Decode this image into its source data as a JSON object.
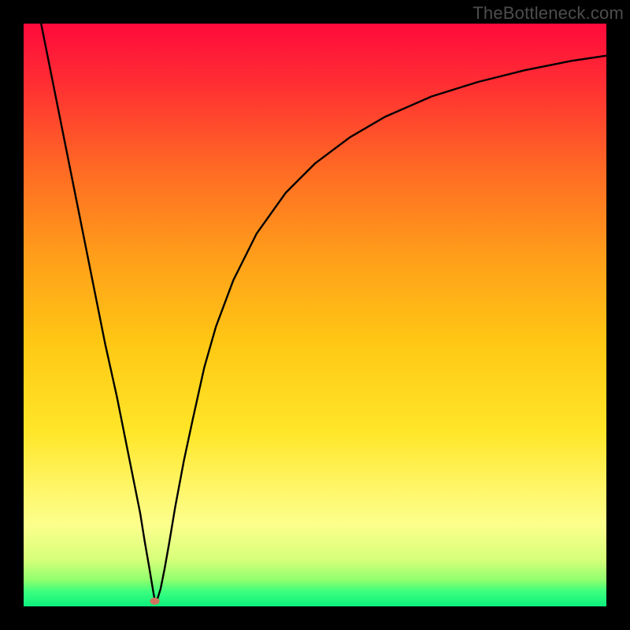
{
  "watermark": "TheBottleneck.com",
  "chart_data": {
    "type": "line",
    "title": "",
    "xlabel": "",
    "ylabel": "",
    "xlim": [
      0,
      100
    ],
    "ylim": [
      0,
      100
    ],
    "grid": false,
    "background_gradient": {
      "stops": [
        {
          "offset": 0.0,
          "color": "#ff0a3c"
        },
        {
          "offset": 0.1,
          "color": "#ff2d33"
        },
        {
          "offset": 0.25,
          "color": "#ff6a24"
        },
        {
          "offset": 0.4,
          "color": "#ff9e1a"
        },
        {
          "offset": 0.55,
          "color": "#ffc814"
        },
        {
          "offset": 0.7,
          "color": "#ffe628"
        },
        {
          "offset": 0.8,
          "color": "#fff66a"
        },
        {
          "offset": 0.86,
          "color": "#fcff8c"
        },
        {
          "offset": 0.92,
          "color": "#d6ff7a"
        },
        {
          "offset": 0.955,
          "color": "#8fff6e"
        },
        {
          "offset": 0.975,
          "color": "#3bff7e"
        },
        {
          "offset": 1.0,
          "color": "#0cf07e"
        }
      ]
    },
    "series": [
      {
        "name": "bottleneck-curve",
        "color": "#000000",
        "width": 2.4,
        "x": [
          3,
          4,
          6,
          8,
          10,
          12,
          14,
          16,
          18,
          19,
          20,
          20.8,
          21.5,
          22,
          22.3,
          22.5,
          22.7,
          23,
          23.5,
          24.2,
          25,
          26,
          27.5,
          29,
          31,
          33,
          36,
          40,
          45,
          50,
          56,
          62,
          70,
          78,
          86,
          94,
          100
        ],
        "y": [
          100,
          95,
          85,
          75,
          65,
          55,
          45,
          36,
          26,
          21,
          16,
          11,
          7,
          4,
          2.2,
          1.2,
          1.0,
          1.4,
          3,
          6.5,
          11,
          17,
          25,
          32,
          41,
          48,
          56,
          64,
          71,
          76,
          80.5,
          84,
          87.5,
          90,
          92,
          93.6,
          94.5
        ]
      }
    ],
    "marker": {
      "name": "optimal-point",
      "x": 22.5,
      "y": 0.9,
      "color": "#d1735e",
      "rx": 6,
      "ry": 4.5
    }
  }
}
